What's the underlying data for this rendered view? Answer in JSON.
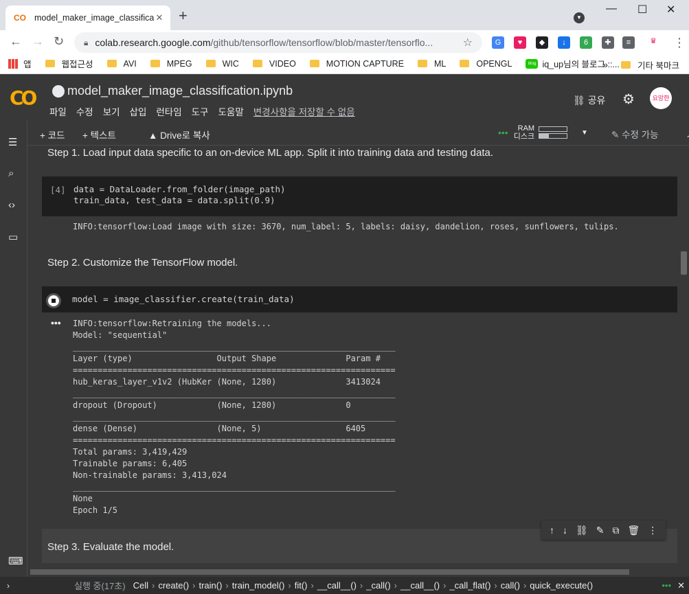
{
  "browser": {
    "tab_title": "model_maker_image_classification.ipy",
    "url_host": "colab.research.google.com",
    "url_path": "/github/tensorflow/tensorflow/blob/master/tensorflo...",
    "profile_badge": "6",
    "bookmarks": [
      "앱",
      "웹접근성",
      "AVI",
      "MPEG",
      "WIC",
      "VIDEO",
      "MOTION CAPTURE",
      "ML",
      "OPENGL",
      "iq_up님의 블로그 ::..."
    ],
    "bookmarks_more": "»",
    "other_bookmarks": "기타 북마크"
  },
  "colab": {
    "logo": "CO",
    "notebook_title": "model_maker_image_classification.ipynb",
    "menu": [
      "파일",
      "수정",
      "보기",
      "삽입",
      "런타임",
      "도구",
      "도움말"
    ],
    "unsaved_notice": "변경사항을 저장할 수 없음",
    "share_label": "공유",
    "avatar_text": "요망한"
  },
  "toolbar": {
    "add_code": "+ 코드",
    "add_text": "+ 텍스트",
    "copy_to_drive": "Drive로 복사",
    "ram_label": "RAM",
    "disk_label": "디스크",
    "ram_usage": 0.0,
    "disk_usage": 0.35,
    "edit_mode": "수정 가능"
  },
  "cells": {
    "step1": "Step 1. Load input data specific to an on-device ML app. Split it into training data and testing data.",
    "cell4_number": "[4]",
    "cell4_line1": "data = DataLoader.from_folder(image_path)",
    "cell4_line2": "train_data, test_data = data.split(0.9)",
    "cell4_output": "INFO:tensorflow:Load image with size: 3670, num_label: 5, labels: daisy, dandelion, roses, sunflowers, tulips.",
    "step2": "Step 2. Customize the TensorFlow model.",
    "cell5_code": "model = image_classifier.create(train_data)",
    "cell5_output": [
      "INFO:tensorflow:Retraining the models...",
      "Model: \"sequential\"",
      "_________________________________________________________________",
      "Layer (type)                 Output Shape              Param #   ",
      "=================================================================",
      "hub_keras_layer_v1v2 (HubKer (None, 1280)              3413024   ",
      "_________________________________________________________________",
      "dropout (Dropout)            (None, 1280)              0         ",
      "_________________________________________________________________",
      "dense (Dense)                (None, 5)                 6405      ",
      "=================================================================",
      "Total params: 3,419,429",
      "Trainable params: 6,405",
      "Non-trainable params: 3,413,024",
      "_________________________________________________________________",
      "None",
      "Epoch 1/5"
    ],
    "output_menu": "•••",
    "step3": "Step 3. Evaluate the model."
  },
  "statusbar": {
    "executing": "실행 중(17초)",
    "breadcrumbs": [
      "Cell",
      "create()",
      "train()",
      "train_model()",
      "fit()",
      "__call__()",
      "_call()",
      "__call__()",
      "_call_flat()",
      "call()",
      "quick_execute()"
    ]
  },
  "icons": [
    "colab-logo-icon",
    "github-icon",
    "link-icon",
    "gear-icon",
    "menu-icon",
    "search-icon",
    "code-icon",
    "folder-icon",
    "pencil-icon",
    "chevron-up-icon",
    "stop-icon",
    "arrow-up-icon",
    "arrow-down-icon",
    "mirror-icon",
    "delete-icon",
    "more-icon",
    "keyboard-icon"
  ]
}
